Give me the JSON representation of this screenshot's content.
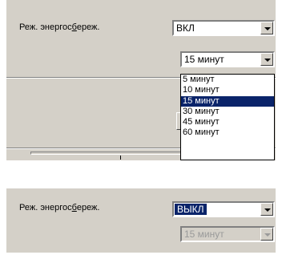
{
  "top": {
    "power_label_pre": "Реж. энергос",
    "power_label_ul": "б",
    "power_label_post": "ереж.",
    "power_value": "ВКЛ",
    "timeout_value": "15 минут",
    "timeout_options": [
      "5 минут",
      "10 минут",
      "15 минут",
      "30 минут",
      "45 минут",
      "60 минут"
    ],
    "timeout_selected_index": 2
  },
  "bottom": {
    "power_label_pre": "Реж. энергос",
    "power_label_ul": "б",
    "power_label_post": "ереж.",
    "power_value": "ВЫКЛ",
    "timeout_value": "15 минут"
  }
}
